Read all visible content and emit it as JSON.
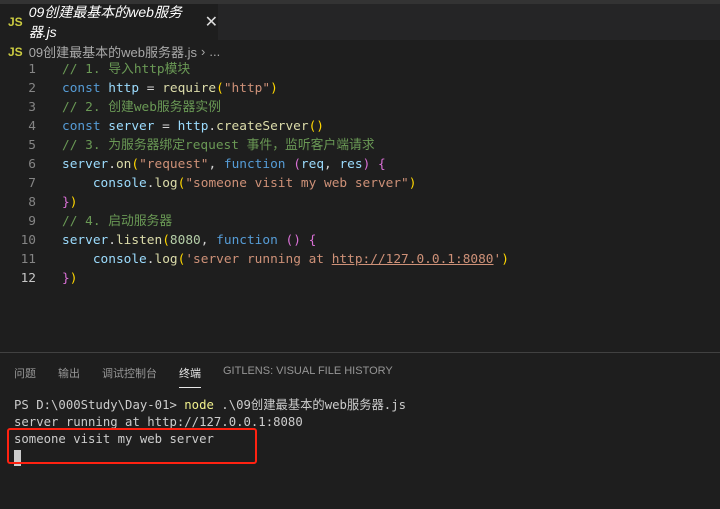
{
  "tab": {
    "icon": "JS",
    "title": "09创建最基本的web服务器.js",
    "close": "✕"
  },
  "breadcrumb": {
    "icon": "JS",
    "file": "09创建最基本的web服务器.js",
    "sep": "›",
    "more": "..."
  },
  "code": [
    {
      "n": "1",
      "t": [
        [
          "com",
          "// 1. 导入http模块"
        ]
      ]
    },
    {
      "n": "2",
      "t": [
        [
          "kw",
          "const "
        ],
        [
          "var",
          "http"
        ],
        [
          "pl",
          " = "
        ],
        [
          "fn",
          "require"
        ],
        [
          "p1",
          "("
        ],
        [
          "str",
          "\"http\""
        ],
        [
          "p1",
          ")"
        ]
      ]
    },
    {
      "n": "3",
      "t": [
        [
          "com",
          "// 2. 创建web服务器实例"
        ]
      ]
    },
    {
      "n": "4",
      "t": [
        [
          "kw",
          "const "
        ],
        [
          "var",
          "server"
        ],
        [
          "pl",
          " = "
        ],
        [
          "var",
          "http"
        ],
        [
          "pl",
          "."
        ],
        [
          "fn",
          "createServer"
        ],
        [
          "p1",
          "()"
        ]
      ]
    },
    {
      "n": "5",
      "t": [
        [
          "com",
          "// 3. 为服务器绑定request 事件，监听客户端请求"
        ]
      ]
    },
    {
      "n": "6",
      "t": [
        [
          "var",
          "server"
        ],
        [
          "pl",
          "."
        ],
        [
          "fn",
          "on"
        ],
        [
          "p1",
          "("
        ],
        [
          "str",
          "\"request\""
        ],
        [
          "pl",
          ", "
        ],
        [
          "kw",
          "function "
        ],
        [
          "p2",
          "("
        ],
        [
          "var",
          "req"
        ],
        [
          "pl",
          ", "
        ],
        [
          "var",
          "res"
        ],
        [
          "p2",
          ")"
        ],
        [
          "pl",
          " "
        ],
        [
          "p2",
          "{"
        ]
      ]
    },
    {
      "n": "7",
      "t": [
        [
          "pl",
          "    "
        ],
        [
          "var",
          "console"
        ],
        [
          "pl",
          "."
        ],
        [
          "fn",
          "log"
        ],
        [
          "p1",
          "("
        ],
        [
          "str",
          "\"someone visit my web server\""
        ],
        [
          "p1",
          ")"
        ]
      ]
    },
    {
      "n": "8",
      "t": [
        [
          "p2",
          "}"
        ],
        [
          "p1",
          ")"
        ]
      ]
    },
    {
      "n": "9",
      "t": [
        [
          "com",
          "// 4. 启动服务器"
        ]
      ]
    },
    {
      "n": "10",
      "t": [
        [
          "var",
          "server"
        ],
        [
          "pl",
          "."
        ],
        [
          "fn",
          "listen"
        ],
        [
          "p1",
          "("
        ],
        [
          "num",
          "8080"
        ],
        [
          "pl",
          ", "
        ],
        [
          "kw",
          "function "
        ],
        [
          "p2",
          "()"
        ],
        [
          "pl",
          " "
        ],
        [
          "p2",
          "{"
        ]
      ]
    },
    {
      "n": "11",
      "t": [
        [
          "pl",
          "    "
        ],
        [
          "var",
          "console"
        ],
        [
          "pl",
          "."
        ],
        [
          "fn",
          "log"
        ],
        [
          "p1",
          "("
        ],
        [
          "str",
          "'server running at "
        ],
        [
          "link",
          "http://127.0.0.1:8080"
        ],
        [
          "str",
          "'"
        ],
        [
          "p1",
          ")"
        ]
      ]
    },
    {
      "n": "12",
      "t": [
        [
          "p2",
          "}"
        ],
        [
          "p1",
          ")"
        ]
      ]
    }
  ],
  "panel": {
    "tabs": [
      "问题",
      "输出",
      "调试控制台",
      "终端",
      "GITLENS: VISUAL FILE HISTORY"
    ],
    "active": 3
  },
  "terminal": {
    "prompt": "PS D:\\000Study\\Day-01> ",
    "cmd": "node",
    "args": " .\\09创建最基本的web服务器.js",
    "out1": "server running at http://127.0.0.1:8080",
    "out2": "someone visit my web server"
  },
  "highlight_color": "#ff2211"
}
